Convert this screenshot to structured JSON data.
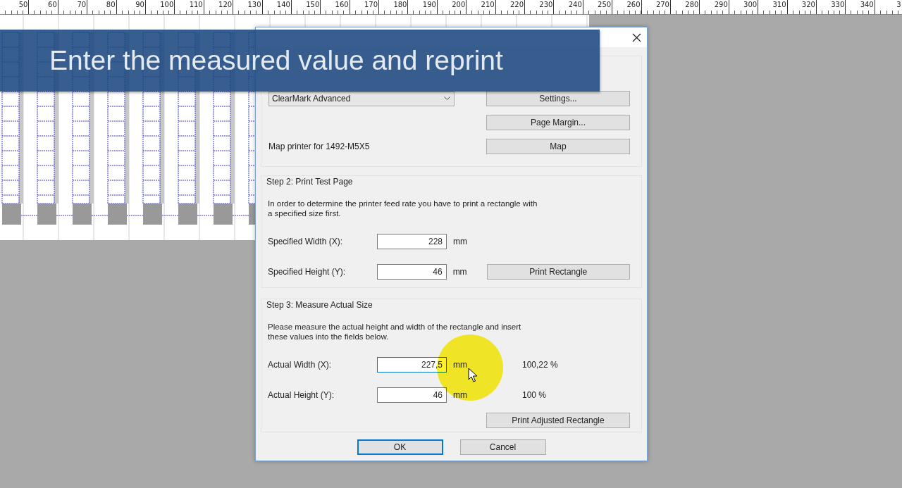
{
  "ruler": {
    "labels": [
      "50",
      "60",
      "70",
      "80",
      "90",
      "100",
      "110",
      "120",
      "130",
      "140",
      "150",
      "160",
      "170",
      "180",
      "190",
      "200",
      "210",
      "220",
      "230",
      "240",
      "250",
      "260",
      "270",
      "280",
      "290",
      "300",
      "310",
      "320",
      "330",
      "340",
      "3"
    ]
  },
  "banner": {
    "text": "Enter the measured value and reprint"
  },
  "dialog": {
    "step1": {
      "printer": "ClearMark Advanced",
      "settings_button": "Settings...",
      "page_margin_button": "Page Margin...",
      "map_label": "Map printer for 1492-M5X5",
      "map_button": "Map"
    },
    "step2": {
      "title": "Step 2: Print Test Page",
      "description": "In order to determine the printer feed rate you have to print a rectangle with\na specified size first.",
      "fields": [
        {
          "label": "Specified Width (X):",
          "value": "228",
          "unit": "mm",
          "focused": false
        },
        {
          "label": "Specified Height (Y):",
          "value": "46",
          "unit": "mm",
          "focused": false
        }
      ],
      "button": "Print Rectangle"
    },
    "step3": {
      "title": "Step 3: Measure Actual Size",
      "description": "Please measure the actual height and width of the rectangle and insert\nthese values into the fields below.",
      "fields": [
        {
          "label": "Actual Width (X):",
          "value": "227,5",
          "unit": "mm",
          "percent": "100,22 %",
          "focused": true
        },
        {
          "label": "Actual Height (Y):",
          "value": "46",
          "unit": "mm",
          "percent": "100 %",
          "focused": false
        }
      ],
      "button": "Print Adjusted Rectangle"
    },
    "buttons": [
      {
        "label": "OK",
        "default": true
      },
      {
        "label": "Cancel",
        "default": false
      }
    ]
  }
}
